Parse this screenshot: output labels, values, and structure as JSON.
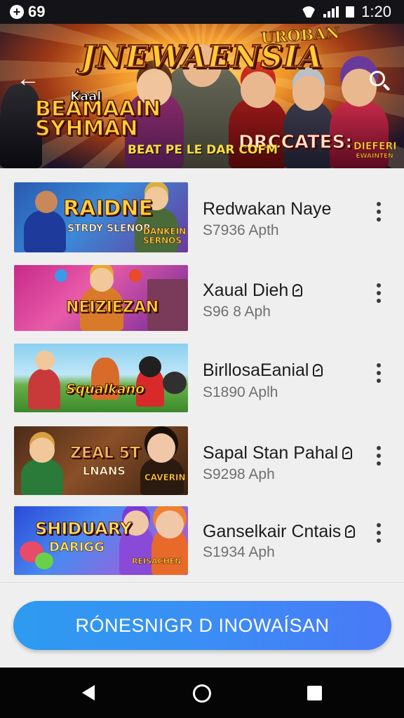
{
  "status_bar": {
    "notification_count": "69",
    "time": "1:20"
  },
  "header": {
    "title": "JNEWAENSIA",
    "logo_text": "UROBAN",
    "left_kicker": "Kaal",
    "left_title_line1": "BEAMAAIN",
    "left_title_line2": "SYHMAN",
    "right_title": "DRCCATES:",
    "tagline": "BEAT PE LE DAR COFM",
    "corner_title": "DIEFERI",
    "corner_sub": "EWAINTEN"
  },
  "games": [
    {
      "name": "Redwakan Naye",
      "subtitle": "S7936 Apth",
      "thumb_title": "RAIDNE",
      "thumb_sub": "STRDY SLENOR",
      "thumb_tag": "DANKEIN SERNOS",
      "has_pin": false
    },
    {
      "name": "Xaual Dieh",
      "subtitle": "S96 8 Aph",
      "thumb_title": "NEIZIEZAN",
      "thumb_sub": "",
      "thumb_tag": "",
      "has_pin": true
    },
    {
      "name": "BirllosaEanial",
      "subtitle": "S1890 Aplh",
      "thumb_title": "Squalkano",
      "thumb_sub": "",
      "thumb_tag": "",
      "has_pin": true
    },
    {
      "name": "Sapal Stan Pahal",
      "subtitle": "S9298 Aph",
      "thumb_title": "ZEAL 5T",
      "thumb_sub": "LNANS",
      "thumb_tag": "CAVERIN",
      "has_pin": true
    },
    {
      "name": "Ganselkair Cntais",
      "subtitle": "S1934 Aph",
      "thumb_title": "SHIDUARY",
      "thumb_sub": "DARIGG",
      "thumb_tag": "REISACHEN",
      "has_pin": true
    }
  ],
  "cta": {
    "label": "RÓNESNIGR D INOWAÍSAN"
  }
}
